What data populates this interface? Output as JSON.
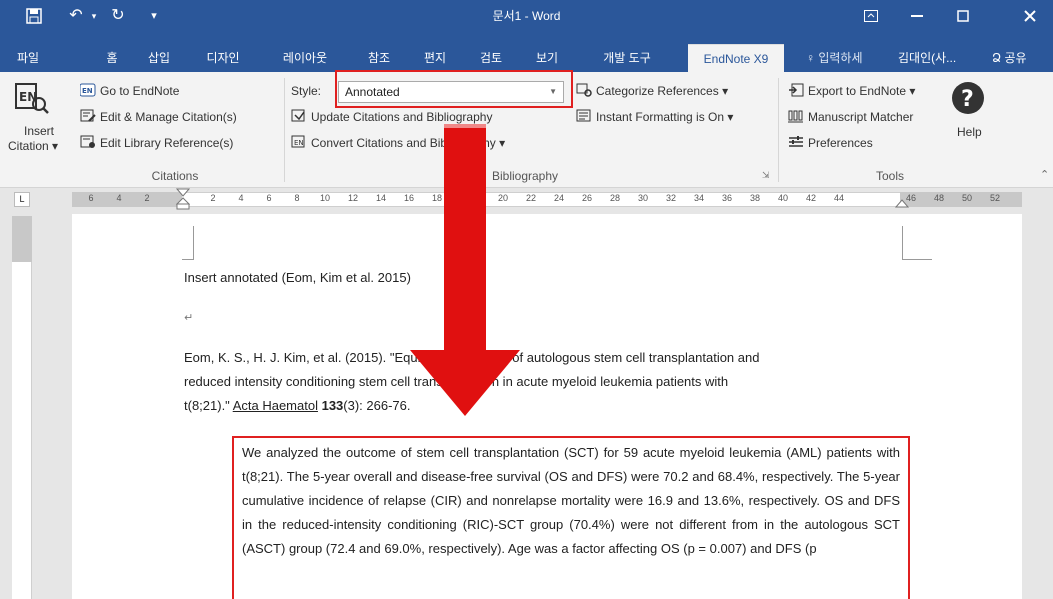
{
  "titlebar": {
    "title": "문서1 - Word",
    "save_icon": "save-icon",
    "undo_glyph": "↶",
    "redo_glyph": "↻",
    "customize_glyph": "▾"
  },
  "tabs": [
    "파일",
    "홈",
    "삽입",
    "디자인",
    "레이아웃",
    "참조",
    "편지",
    "검토",
    "보기",
    "개발 도구",
    "EndNote X9"
  ],
  "tell_me": "♀ 입력하세",
  "user": "김대인(사...",
  "share": "Ձ 공유",
  "ribbon": {
    "insert_citation": [
      "Insert",
      "Citation ▾"
    ],
    "go_to_endnote": "Go to EndNote",
    "edit_manage": "Edit & Manage Citation(s)",
    "edit_library": "Edit Library Reference(s)",
    "citations_group": "Citations",
    "style_label": "Style:",
    "style_value": "Annotated",
    "update_citations": "Update Citations and Bibliography",
    "convert_citations": "Convert Citations and Bibliography ▾",
    "categorize": "Categorize References ▾",
    "instant_formatting": "Instant Formatting is On ▾",
    "bibliography_group": "Bibliography",
    "export": "Export to EndNote ▾",
    "manuscript_matcher": "Manuscript Matcher",
    "preferences": "Preferences",
    "tools_group": "Tools",
    "help": "Help"
  },
  "ruler": [
    "6",
    "4",
    "2",
    "2",
    "4",
    "6",
    "8",
    "10",
    "12",
    "14",
    "16",
    "18",
    "20",
    "22",
    "24",
    "26",
    "28",
    "30",
    "32",
    "34",
    "36",
    "38",
    "40",
    "42",
    "44",
    "46",
    "48",
    "50",
    "52"
  ],
  "document": {
    "line1": "Insert annotated (Eom, Kim et al. 2015)",
    "para_mark": "↵",
    "ref_line1": "Eom, K. S., H. J. Kim, et al. (2015). \"Equivalent outcome of autologous stem cell transplantation and",
    "ref_line2": "reduced intensity conditioning stem cell transplantation in acute myeloid leukemia patients with",
    "ref_line3_pre": "t(8;21).\" ",
    "ref_journal": "Acta Haematol",
    "ref_volume": "133",
    "ref_rest": "(3): 266-76.",
    "abstract": "We analyzed the outcome of stem cell transplantation (SCT) for 59 acute myeloid leukemia (AML) patients with t(8;21). The 5-year overall and disease-free survival (OS and DFS) were 70.2 and 68.4%, respectively. The 5-year cumulative incidence of relapse (CIR) and nonrelapse mortality were 16.9 and 13.6%, respectively. OS and DFS in the reduced-intensity conditioning (RIC)-SCT group (70.4%) were not different from in the autologous SCT (ASCT) group (72.4 and 69.0%, respectively). Age was a factor affecting OS (p = 0.007) and DFS (p"
  },
  "colors": {
    "accent": "#2b579a",
    "highlight": "#e02020"
  }
}
